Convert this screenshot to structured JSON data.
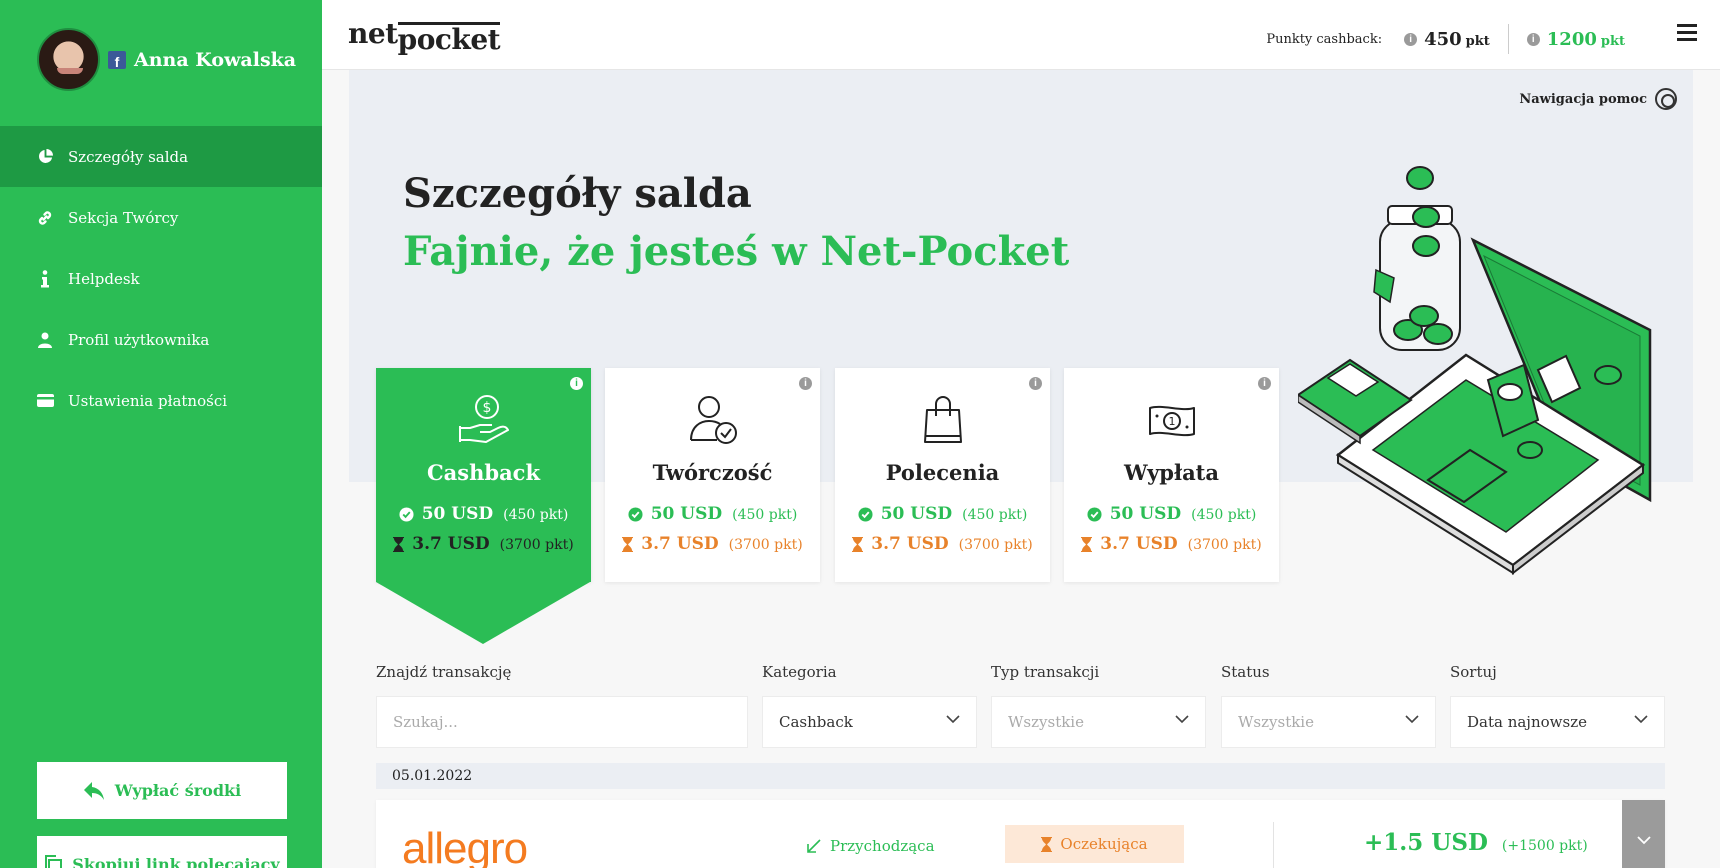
{
  "sidebar": {
    "user_name": "Anna Kowalska",
    "items": [
      {
        "label": "Szczegóły salda",
        "icon": "pie-chart-icon",
        "active": true
      },
      {
        "label": "Sekcja Twórcy",
        "icon": "link-icon"
      },
      {
        "label": "Helpdesk",
        "icon": "info-icon"
      },
      {
        "label": "Profil użytkownika",
        "icon": "user-icon"
      },
      {
        "label": "Ustawienia płatności",
        "icon": "credit-card-icon"
      }
    ],
    "withdraw_label": "Wypłać środki",
    "copy_link_label": "Skopiuj link polecający"
  },
  "header": {
    "logo_top": "net",
    "logo_bottom": "pocket",
    "points_label": "Punkty cashback:",
    "points_1": "450",
    "points_2": "1200",
    "points_unit": "pkt"
  },
  "hero": {
    "help_label": "Nawigacja pomoc",
    "title": "Szczegóły salda",
    "subtitle": "Fajnie, że jesteś w Net-Pocket"
  },
  "cards": [
    {
      "title": "Cashback",
      "confirmed": "50 USD",
      "confirmed_pts": "(450 pkt)",
      "pending": "3.7 USD",
      "pending_pts": "(3700 pkt)"
    },
    {
      "title": "Twórczość",
      "confirmed": "50 USD",
      "confirmed_pts": "(450 pkt)",
      "pending": "3.7 USD",
      "pending_pts": "(3700 pkt)"
    },
    {
      "title": "Polecenia",
      "confirmed": "50 USD",
      "confirmed_pts": "(450 pkt)",
      "pending": "3.7 USD",
      "pending_pts": "(3700 pkt)"
    },
    {
      "title": "Wypłata",
      "confirmed": "50 USD",
      "confirmed_pts": "(450 pkt)",
      "pending": "3.7 USD",
      "pending_pts": "(3700 pkt)"
    }
  ],
  "filters": {
    "search_label": "Znajdź transakcję",
    "search_placeholder": "Szukaj...",
    "category_label": "Kategoria",
    "category_value": "Cashback",
    "type_label": "Typ transakcji",
    "type_value": "Wszystkie",
    "status_label": "Status",
    "status_value": "Wszystkie",
    "sort_label": "Sortuj",
    "sort_value": "Data najnowsze"
  },
  "transactions": {
    "date": "05.01.2022",
    "items": [
      {
        "merchant": "allegro",
        "type": "Przychodząca",
        "status": "Oczekująca",
        "amount": "+1.5 USD",
        "points": "(+1500 pkt)"
      }
    ]
  },
  "colors": {
    "brand_green": "#2bbd55",
    "dark_green": "#1e9a44",
    "pending_orange": "#e8822a",
    "allegro_orange": "#f47b20"
  }
}
